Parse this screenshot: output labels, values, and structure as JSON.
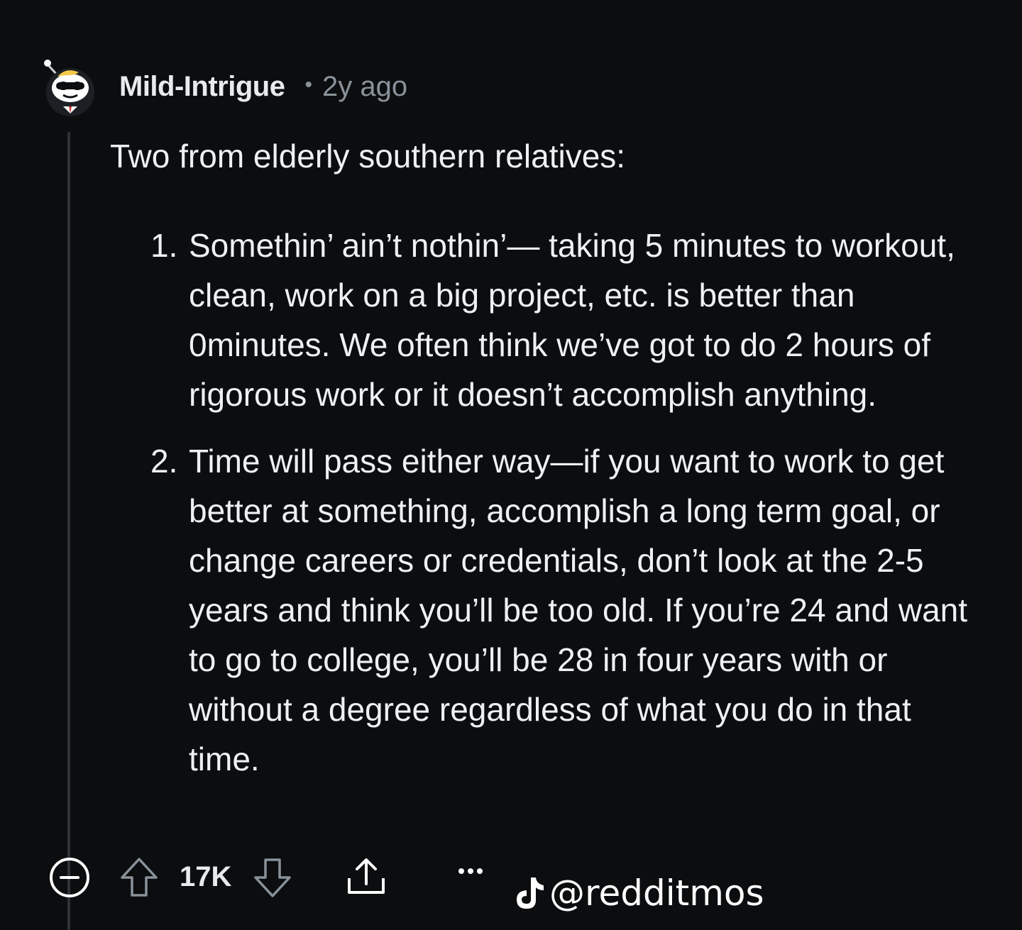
{
  "comment": {
    "author": "Mild-Intrigue",
    "separator": "•",
    "age": "2y ago",
    "intro": "Two from elderly southern relatives:",
    "list": [
      {
        "number": "1.",
        "text": "Somethin’ ain’t nothin’— taking 5 minutes to workout, clean, work on a big project, etc. is better than 0minutes. We often think we’ve got to do 2 hours of rigorous work or it doesn’t accomplish anything."
      },
      {
        "number": "2.",
        "text": "Time will pass either way—if you want to work to get better at something, accomplish a long term goal, or change careers or credentials, don’t look at the 2-5 years and think you’ll be too old. If you’re 24 and want to go to college, you’ll be 28 in four years with or without a degree regardless of what you do in that time."
      }
    ]
  },
  "actions": {
    "collapse_icon": "minus-circle-icon",
    "upvote_icon": "arrow-up-icon",
    "score": "17K",
    "downvote_icon": "arrow-down-icon",
    "share_icon": "share-icon",
    "more_icon": "ellipsis-icon"
  },
  "watermark": {
    "icon": "tiktok-icon",
    "handle": "@redditmos"
  },
  "colors": {
    "background": "#0b0d0f",
    "text": "#eef1f3",
    "meta": "#8a9299",
    "thread_line": "#2e3338"
  }
}
